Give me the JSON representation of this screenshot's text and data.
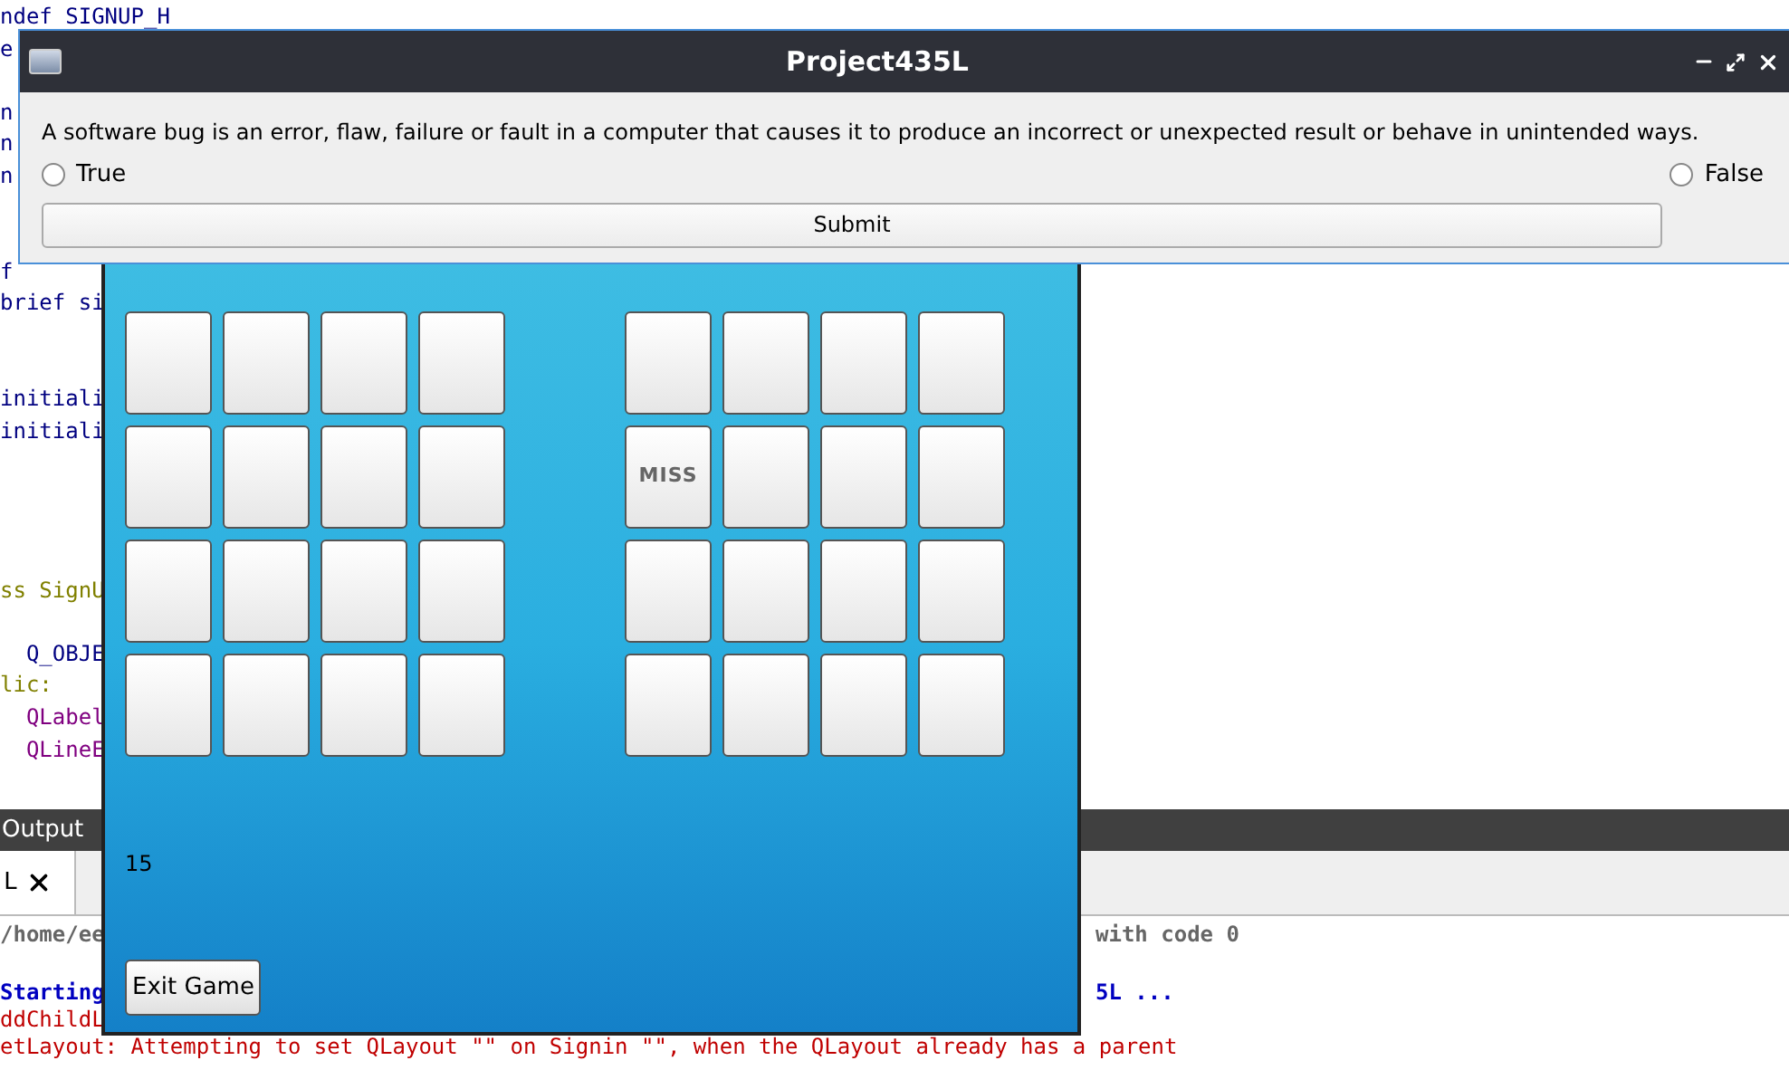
{
  "editor": {
    "lines": [
      {
        "text": "ndef SIGNUP_H",
        "kind": "preproc"
      },
      {
        "text": "e",
        "kind": "preproc"
      },
      {
        "kind": "blank"
      },
      {
        "text": "n",
        "kind": "preproc"
      },
      {
        "text": "n",
        "kind": "preproc"
      },
      {
        "text": "n",
        "kind": "preproc"
      },
      {
        "kind": "blank"
      },
      {
        "kind": "blank"
      },
      {
        "text": "f",
        "kind": "preproc"
      },
      {
        "text": "brief si",
        "kind": "comment"
      },
      {
        "kind": "blank"
      },
      {
        "kind": "blank"
      },
      {
        "text": "initiali",
        "kind": "comment"
      },
      {
        "text": "initiali",
        "kind": "comment"
      },
      {
        "kind": "blank"
      },
      {
        "kind": "blank"
      },
      {
        "kind": "blank"
      },
      {
        "kind": "blank"
      },
      {
        "text": "ss SignU",
        "kind": "class"
      },
      {
        "kind": "blank"
      },
      {
        "text": "  Q_OBJE",
        "kind": "preproc"
      },
      {
        "text": "lic:",
        "kind": "keyword"
      },
      {
        "text": "  QLabel",
        "kind": "type"
      },
      {
        "text": "  QLineE",
        "kind": "type"
      }
    ]
  },
  "output": {
    "title": "Output",
    "tab": {
      "label": "L",
      "selected": true
    },
    "lines": [
      {
        "left": "/home/ee",
        "right": "with code 0",
        "kind": "info"
      },
      {
        "kind": "blank"
      },
      {
        "left": "Starting",
        "right": "5L ...",
        "kind": "start"
      },
      {
        "left": "ddChildL",
        "kind": "error"
      },
      {
        "left": "etLayout: Attempting to set QLayout \"\" on Signin \"\", when the QLayout already has a parent",
        "kind": "error"
      }
    ]
  },
  "game": {
    "grids": [
      {
        "rows": [
          [
            {
              "kind": "blank"
            },
            {
              "kind": "blank"
            },
            {
              "kind": "blank"
            },
            {
              "kind": "blank"
            }
          ],
          [
            {
              "kind": "blank"
            },
            {
              "kind": "blank"
            },
            {
              "kind": "blank"
            },
            {
              "kind": "blank"
            }
          ],
          [
            {
              "kind": "blank"
            },
            {
              "kind": "blank"
            },
            {
              "kind": "blank"
            },
            {
              "kind": "blank"
            }
          ],
          [
            {
              "kind": "blank"
            },
            {
              "kind": "blank"
            },
            {
              "kind": "blank"
            },
            {
              "kind": "blank"
            }
          ]
        ]
      },
      {
        "rows": [
          [
            {
              "kind": "blank"
            },
            {
              "kind": "blank"
            },
            {
              "kind": "blank"
            },
            {
              "kind": "blank"
            }
          ],
          [
            {
              "kind": "text",
              "label": "MISS"
            },
            {
              "kind": "blank"
            },
            {
              "kind": "blank"
            },
            {
              "kind": "blank"
            }
          ],
          [
            {
              "kind": "blank"
            },
            {
              "kind": "blank"
            },
            {
              "kind": "blank"
            },
            {
              "kind": "blank"
            }
          ],
          [
            {
              "kind": "blank"
            },
            {
              "kind": "blank"
            },
            {
              "kind": "blank"
            },
            {
              "kind": "blank"
            }
          ]
        ]
      }
    ],
    "score": "15",
    "exit_button": "Exit Game"
  },
  "dialog": {
    "title": "Project435L",
    "question": "A software bug is an error, flaw, failure or fault in a computer that causes it to produce an incorrect or unexpected result or behave in unintended ways.",
    "options": [
      {
        "label": "True",
        "selected": false
      },
      {
        "label": "False",
        "selected": false
      }
    ],
    "submit": "Submit"
  }
}
